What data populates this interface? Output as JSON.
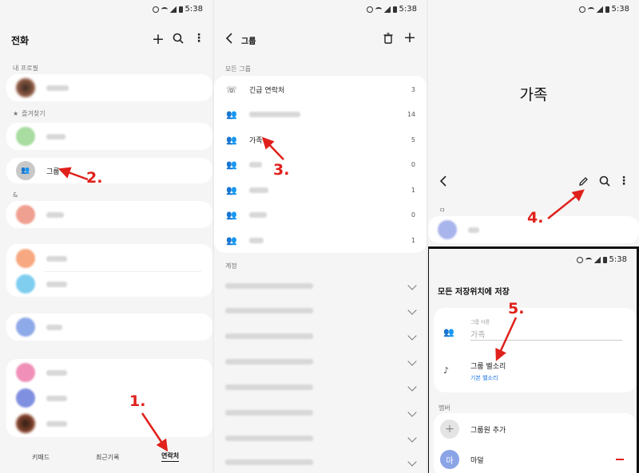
{
  "status": {
    "time": "5:38"
  },
  "screen1": {
    "title": "전화",
    "my_profile_section": "내 프로필",
    "favorites_section": "즐겨찾기",
    "groups_label": "그룹",
    "section_amp": "&",
    "tabs": {
      "keypad": "키패드",
      "recents": "최근기록",
      "contacts": "연락처"
    }
  },
  "screen2": {
    "title": "그룹",
    "all_groups_section": "모든 그룹",
    "emergency_label": "긴급 연락처",
    "emergency_count": "3",
    "group2_count": "14",
    "family_label": "가족",
    "family_count": "5",
    "group4_count": "0",
    "group5_count": "1",
    "group6_count": "0",
    "group7_count": "1",
    "accounts_section": "계정"
  },
  "screen3": {
    "big_title": "가족",
    "contact_section": "ㅁ",
    "sheet_title": "모든 저장위치에 저장",
    "group_name_caption": "그룹 이름",
    "group_name_value": "가족",
    "ringtone_label": "그룹 벨소리",
    "ringtone_value": "기본 벨소리",
    "members_section": "멤버",
    "add_member_label": "그룹원 추가",
    "member_avatar_letter": "마",
    "member_name": "마덜"
  },
  "annotations": {
    "a1": "1.",
    "a2": "2.",
    "a3": "3.",
    "a4": "4.",
    "a5": "5."
  },
  "colors": {
    "annotation": "#e0201b",
    "accent_link": "#1a73e8"
  }
}
